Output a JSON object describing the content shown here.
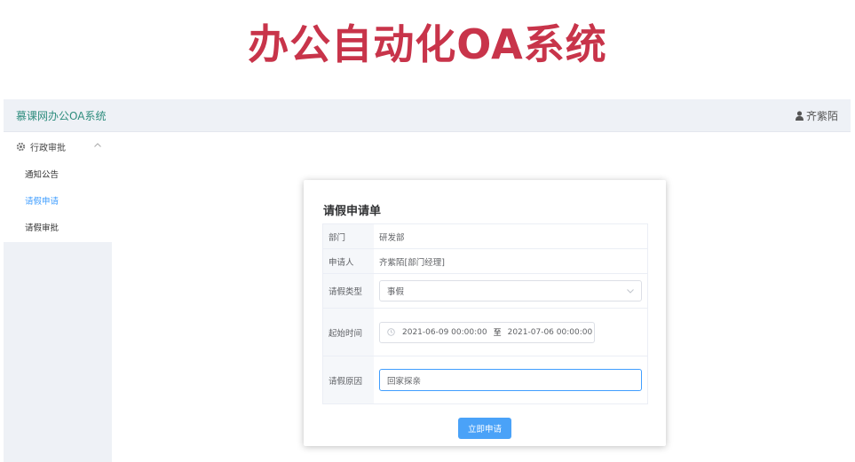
{
  "banner": {
    "title": "办公自动化OA系统"
  },
  "header": {
    "app_title": "慕课网办公OA系统",
    "user_name": "齐紫陌"
  },
  "sidebar": {
    "group_label": "行政审批",
    "items": [
      {
        "label": "通知公告",
        "active": false
      },
      {
        "label": "请假申请",
        "active": true
      },
      {
        "label": "请假审批",
        "active": false
      }
    ]
  },
  "form": {
    "title": "请假申请单",
    "department": {
      "label": "部门",
      "value": "研发部"
    },
    "applicant": {
      "label": "申请人",
      "value": "齐紫陌[部门经理]"
    },
    "leave_type": {
      "label": "请假类型",
      "value": "事假"
    },
    "time": {
      "label": "起始时间",
      "start": "2021-06-09 00:00:00",
      "separator": "至",
      "end": "2021-07-06 00:00:00"
    },
    "reason": {
      "label": "请假原因",
      "value": "回家探亲"
    },
    "submit_label": "立即申请"
  },
  "colors": {
    "banner": "#c8344a",
    "accent": "#409eff",
    "brand": "#2f8d7e"
  }
}
